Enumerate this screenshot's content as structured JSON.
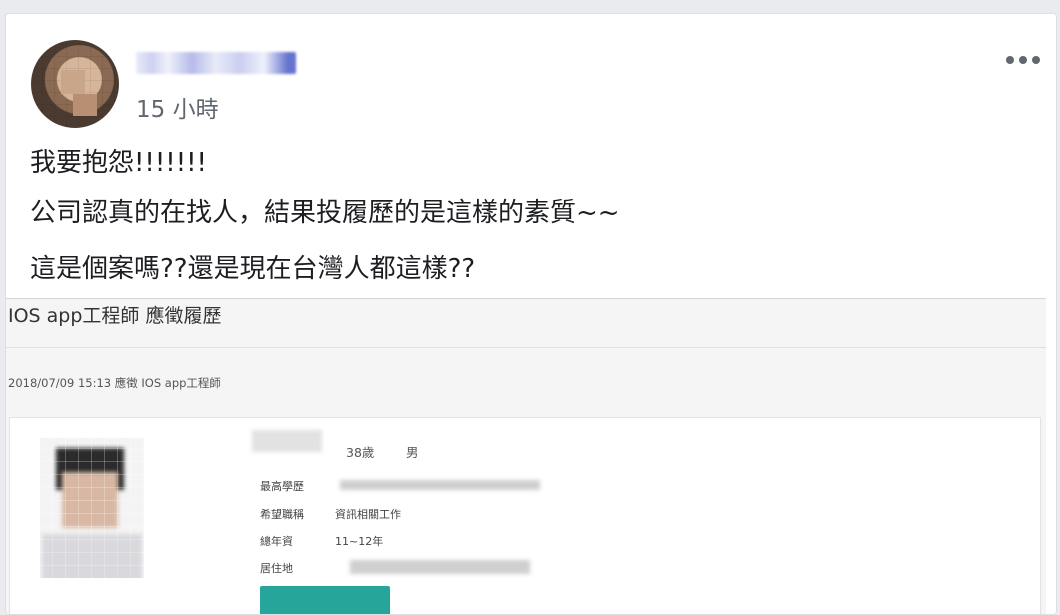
{
  "post": {
    "time": "15 小時",
    "lines": [
      "我要抱怨!!!!!!!",
      "公司認真的在找人，結果投履歷的是這樣的素質~~",
      "這是個案嗎??還是現在台灣人都這樣??"
    ]
  },
  "screenshot": {
    "title": "IOS app工程師  應徵履歷",
    "meta": "2018/07/09 15:13 應徵 IOS app工程師",
    "resume": {
      "age": "38歲",
      "gender": "男",
      "fields": [
        {
          "label": "最高學歷",
          "value": ""
        },
        {
          "label": "希望職稱",
          "value": "資訊相關工作"
        },
        {
          "label": "總年資",
          "value": "11~12年"
        },
        {
          "label": "居住地",
          "value": ""
        }
      ]
    }
  }
}
